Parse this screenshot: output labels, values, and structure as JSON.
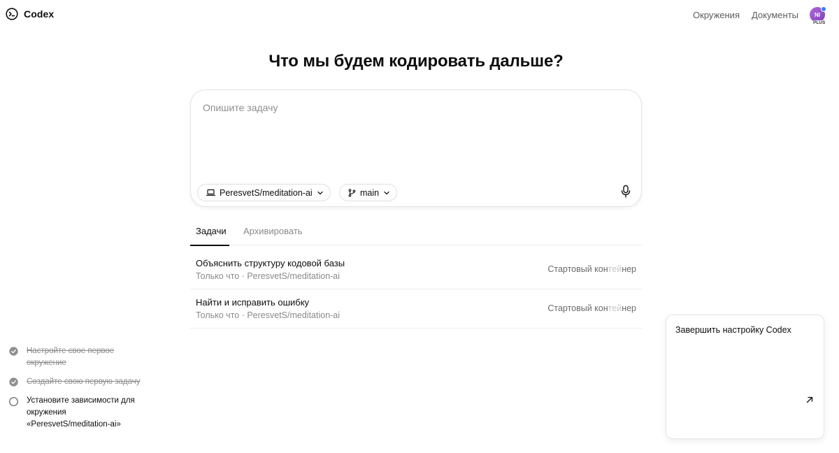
{
  "app": {
    "name": "Codex"
  },
  "nav": {
    "environments": "Окружения",
    "docs": "Документы"
  },
  "user": {
    "initials": "NI",
    "plan": "PLUS"
  },
  "headline": "Что мы будем кодировать дальше?",
  "composer": {
    "placeholder": "Опишите задачу",
    "value": "",
    "repo": "PeresvetS/meditation-ai",
    "branch": "main"
  },
  "tabs": [
    {
      "label": "Задачи",
      "active": true
    },
    {
      "label": "Архивировать",
      "active": false
    }
  ],
  "tasks": [
    {
      "title": "Объяснить структуру кодовой базы",
      "meta": "Только что · PeresvetS/meditation-ai",
      "status_visible": "Стартовый кон",
      "status_faded": "тей",
      "status_tail": "нер"
    },
    {
      "title": "Найти и исправить ошибку",
      "meta": "Только что · PeresvetS/meditation-ai",
      "status_visible": "Стартовый кон",
      "status_faded": "тей",
      "status_tail": "нер"
    }
  ],
  "setup": {
    "title": "Завершить настройку Codex",
    "steps": [
      {
        "label": "Настройте свое первое окружение",
        "done": true
      },
      {
        "label": "Создайте свою первую задачу",
        "done": true
      },
      {
        "label": "Установите зависимости для окружения «PeresvetS/meditation-ai»",
        "done": false
      }
    ]
  },
  "colors": {
    "accent": "#0d0d0d",
    "muted": "#8a8a8a",
    "avatar": "#9b55cf"
  },
  "icons": {
    "logo": "codex-logo-icon",
    "repo": "laptop-icon",
    "branch": "git-branch-icon",
    "chevron": "chevron-down-icon",
    "mic": "microphone-icon",
    "check": "check-circle-icon",
    "pending": "empty-circle-icon",
    "arrow": "arrow-up-right-icon"
  }
}
